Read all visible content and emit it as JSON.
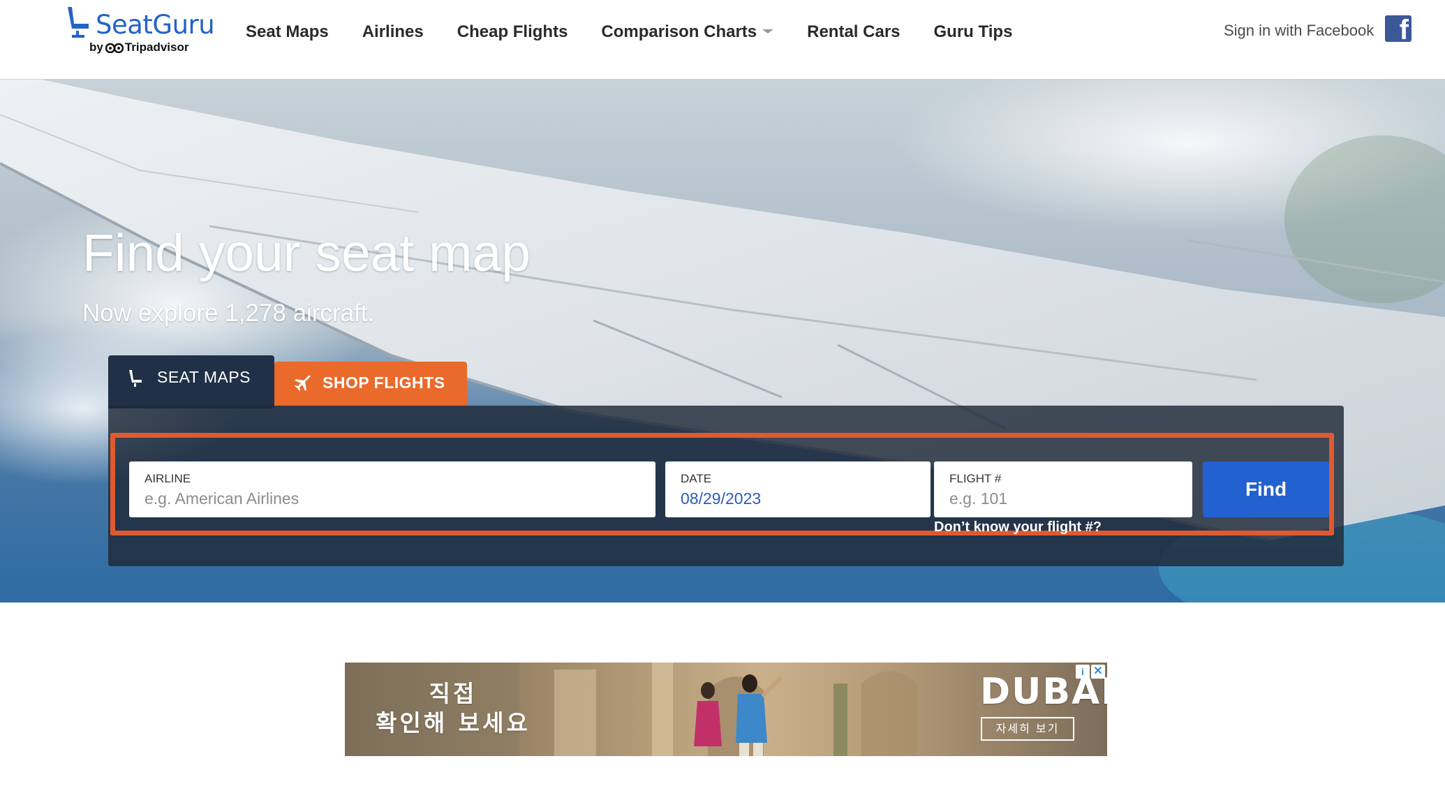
{
  "header": {
    "logo_name": "SeatGuru",
    "logo_by": "by",
    "logo_partner": "Tripadvisor",
    "nav": [
      {
        "label": "Seat Maps"
      },
      {
        "label": "Airlines"
      },
      {
        "label": "Cheap Flights"
      },
      {
        "label": "Comparison Charts",
        "has_dropdown": true
      },
      {
        "label": "Rental Cars"
      },
      {
        "label": "Guru Tips"
      }
    ],
    "signin_label": "Sign in with Facebook",
    "facebook_icon": "facebook-icon"
  },
  "hero": {
    "title": "Find your seat map",
    "subtitle": "Now explore 1,278 aircraft."
  },
  "search": {
    "tabs": {
      "seat_maps": "SEAT MAPS",
      "shop_flights": "SHOP FLIGHTS"
    },
    "airline": {
      "label": "AIRLINE",
      "placeholder": "e.g. American Airlines"
    },
    "date": {
      "label": "DATE",
      "value": "08/29/2023"
    },
    "flight": {
      "label": "FLIGHT #",
      "placeholder": "e.g. 101"
    },
    "find_label": "Find",
    "dont_know_label": "Don’t know your flight #?"
  },
  "ad": {
    "line1": "직접",
    "line2": "확인해 보세요",
    "brand": "DUBAI",
    "cta": "자세히 보기",
    "info_glyph": "i",
    "close_glyph": "✕"
  },
  "colors": {
    "brand_blue": "#2462c8",
    "shop_orange": "#e96a2a",
    "find_blue": "#2360d0",
    "highlight": "#df5a30",
    "facebook": "#3b5998"
  }
}
